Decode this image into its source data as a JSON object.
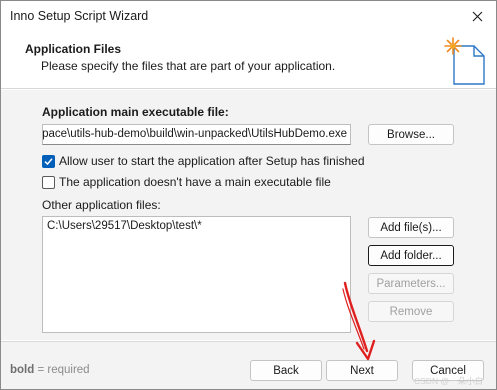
{
  "window": {
    "title": "Inno Setup Script Wizard"
  },
  "header": {
    "title": "Application Files",
    "subtitle": "Please specify the files that are part of your application."
  },
  "main_exe": {
    "label": "Application main executable file:",
    "value": "n_space\\utils-hub-demo\\build\\win-unpacked\\UtilsHubDemo.exe",
    "browse_label": "Browse..."
  },
  "options": {
    "allow_start": {
      "label": "Allow user to start the application after Setup has finished",
      "checked": true
    },
    "no_main_exe": {
      "label": "The application doesn't have a main executable file",
      "checked": false
    }
  },
  "other_files": {
    "label": "Other application files:",
    "items": [
      "C:\\Users\\29517\\Desktop\\test\\*"
    ],
    "add_files_label": "Add file(s)...",
    "add_folder_label": "Add folder...",
    "parameters_label": "Parameters...",
    "remove_label": "Remove"
  },
  "footer": {
    "note_bold": "bold",
    "note_rest": " = required",
    "back_label": "Back",
    "next_label": "Next",
    "cancel_label": "Cancel"
  },
  "watermark": "CSDN @一朵小白",
  "colors": {
    "accent": "#005fb8",
    "annotation_arrow": "#e02020",
    "footer_bg": "#f3f3f3"
  },
  "icons": {
    "close": "close-icon",
    "wizard": "wizard-star-document-icon",
    "check": "checkmark-icon"
  }
}
